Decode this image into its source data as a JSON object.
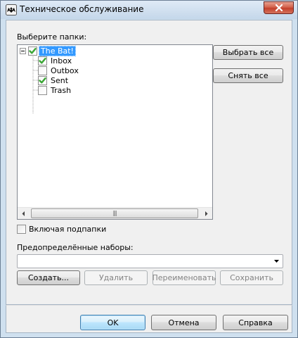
{
  "window": {
    "title": "Техническое обслуживание"
  },
  "folders": {
    "label": "Выберите папки:",
    "tree": {
      "root": {
        "label": "The Bat!",
        "checked": true,
        "selected": true
      },
      "children": [
        {
          "label": "Inbox",
          "checked": true
        },
        {
          "label": "Outbox",
          "checked": false
        },
        {
          "label": "Sent",
          "checked": true
        },
        {
          "label": "Trash",
          "checked": false
        }
      ]
    }
  },
  "side_buttons": {
    "select_all": "Выбрать все",
    "deselect_all": "Снять все"
  },
  "include_subfolders": {
    "label": "Включая подпапки",
    "checked": false
  },
  "presets": {
    "label": "Предопределённые наборы:",
    "value": "",
    "buttons": {
      "create": "Создать...",
      "delete": "Удалить",
      "rename": "Переименовать",
      "save": "Сохранить"
    }
  },
  "dialog_buttons": {
    "ok": "OK",
    "cancel": "Отмена",
    "help": "Справка"
  },
  "colors": {
    "selection": "#3399ff",
    "check_green": "#3aa635",
    "close_red": "#c3402b"
  }
}
